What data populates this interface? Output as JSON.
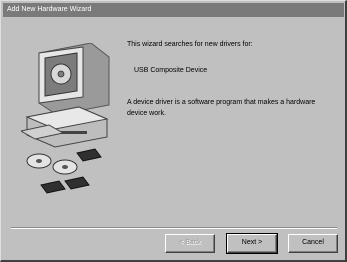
{
  "window": {
    "title": "Add New Hardware Wizard"
  },
  "content": {
    "intro": "This wizard searches for new drivers for:",
    "device_name": "USB Composite Device",
    "description": "A device driver is a software program that makes a hardware device work."
  },
  "buttons": {
    "back": "< Back",
    "next": "Next >",
    "cancel": "Cancel"
  },
  "icons": {
    "illustration": "computer-with-discs-icon"
  }
}
